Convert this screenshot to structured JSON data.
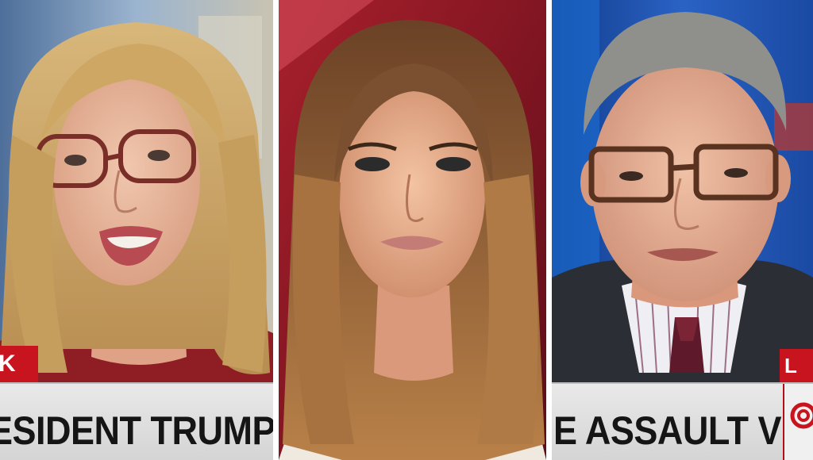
{
  "panels": {
    "left": {
      "tag": "K",
      "chyron": "ESIDENT TRUMP'S MI"
    },
    "middle": {},
    "right": {
      "tag": "L",
      "chyron": "E ASSAULT VICTIMS"
    }
  },
  "colors": {
    "chyron_red": "#c8141e",
    "chyron_bg": "#e0e0e0",
    "chyron_text": "#151515",
    "divider": "#ffffff"
  },
  "icons": {
    "network_logo": "cnn-logo-icon"
  }
}
